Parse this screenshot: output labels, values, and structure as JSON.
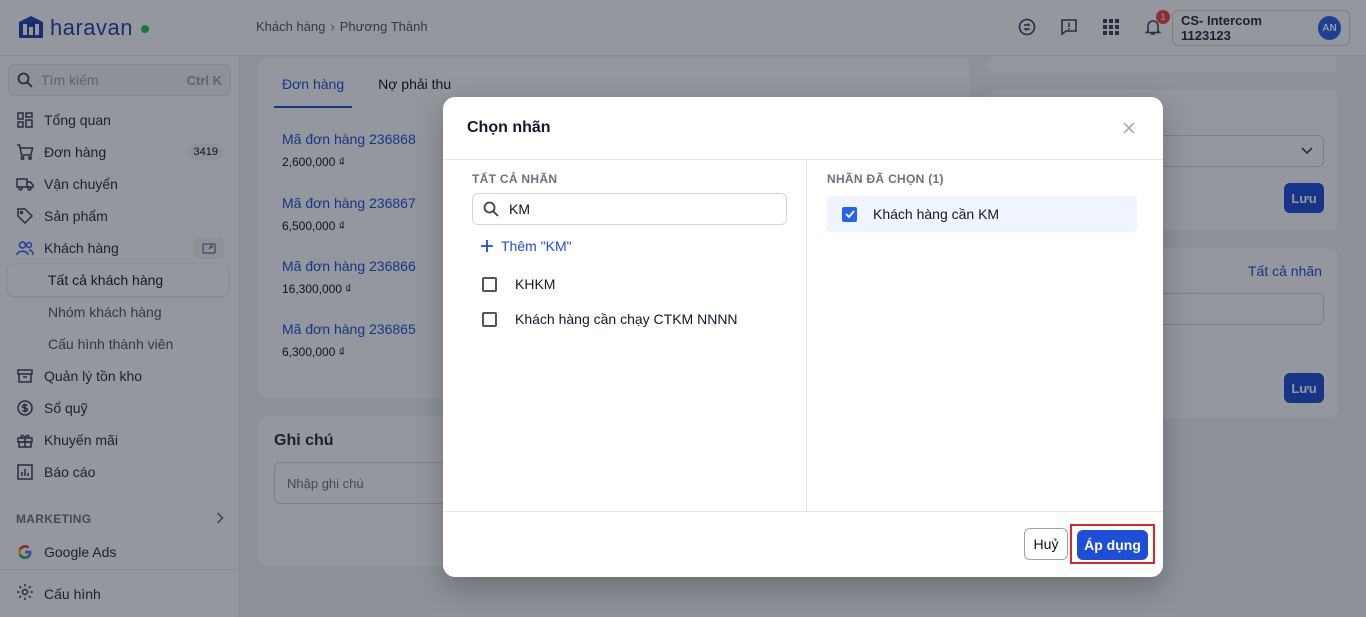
{
  "brand": {
    "name": "haravan",
    "accent": "#1e40af",
    "status_dot": "#22c55e"
  },
  "breadcrumb": {
    "parent": "Khách hàng",
    "current": "Phương Thành"
  },
  "topbar": {
    "notification_count": "1",
    "account_name": "CS- Intercom 1123123",
    "avatar_initials": "AN"
  },
  "sidebar": {
    "search_placeholder": "Tìm kiếm",
    "search_shortcut": "Ctrl K",
    "items": [
      {
        "label": "Tổng quan",
        "icon": "dashboard-icon"
      },
      {
        "label": "Đơn hàng",
        "icon": "cart-icon",
        "count": "3419"
      },
      {
        "label": "Vận chuyển",
        "icon": "truck-icon"
      },
      {
        "label": "Sản phẩm",
        "icon": "tag-icon"
      },
      {
        "label": "Khách hàng",
        "icon": "users-icon"
      }
    ],
    "sub_items": [
      "Tất cả khách hàng",
      "Nhóm khách hàng",
      "Cấu hình thành viên"
    ],
    "items2": [
      {
        "label": "Quản lý tồn kho",
        "icon": "box-icon"
      },
      {
        "label": "Sổ quỹ",
        "icon": "dollar-icon"
      },
      {
        "label": "Khuyến mãi",
        "icon": "gift-icon"
      },
      {
        "label": "Báo cáo",
        "icon": "chart-icon"
      }
    ],
    "marketing_label": "MARKETING",
    "google_ads": "Google Ads",
    "settings": "Cấu hình"
  },
  "background": {
    "tabs": [
      "Đơn hàng",
      "Nợ phải thu"
    ],
    "orders": [
      {
        "code": "Mã đơn hàng 236868",
        "amount": "2,600,000 ₫"
      },
      {
        "code": "Mã đơn hàng 236867",
        "amount": "6,500,000 ₫"
      },
      {
        "code": "Mã đơn hàng 236866",
        "amount": "16,300,000 ₫"
      },
      {
        "code": "Mã đơn hàng 236865",
        "amount": "6,300,000 ₫"
      }
    ],
    "note_title": "Ghi chú",
    "note_placeholder": "Nhập ghi chú",
    "save_label": "Lưu",
    "all_tags_link": "Tất cả nhãn"
  },
  "modal": {
    "title": "Chọn nhãn",
    "left_label": "TẤT CẢ NHÃN",
    "search_value": "KM",
    "add_label": "Thêm \"KM\"",
    "options": [
      "KHKM",
      "Khách hàng cần chạy CTKM NNNN"
    ],
    "right_label": "NHÃN ĐÃ CHỌN (1)",
    "selected": [
      "Khách hàng cần KM"
    ],
    "cancel_label": "Huỷ",
    "apply_label": "Áp dụng"
  }
}
